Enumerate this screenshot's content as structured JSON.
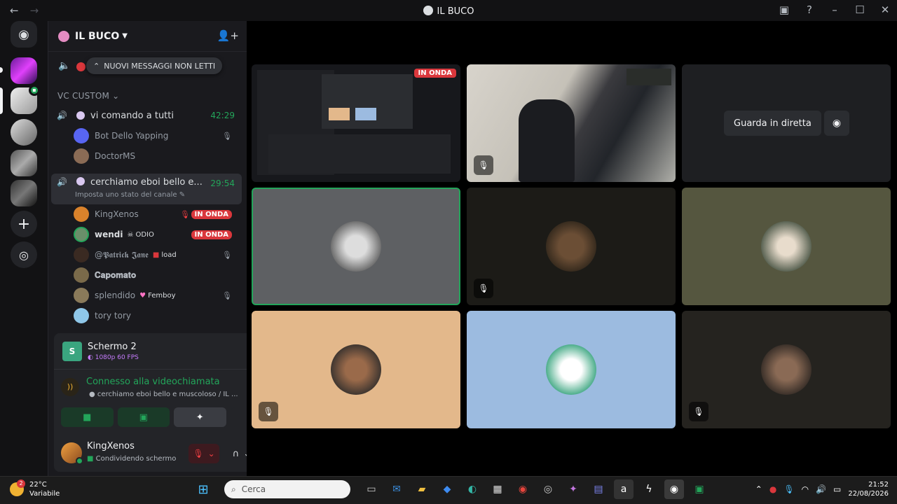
{
  "window": {
    "title": "IL BUCO"
  },
  "sidebar": {
    "server_name": "IL BUCO",
    "new_messages_pill": "NUOVI MESSAGGI NON LETTI",
    "category": "VC CUSTOM",
    "channel1": {
      "name": "vi comando a tutti",
      "timer": "42:29"
    },
    "channel1_users": [
      {
        "name": "Bot Dello Yapping"
      },
      {
        "name": "DoctorMS"
      }
    ],
    "channel2": {
      "name": "cerchiamo eboi bello e...",
      "timer": "29:54",
      "status_hint": "Imposta uno stato del canale"
    },
    "channel2_users": [
      {
        "name": "KingXenos",
        "live": "IN ONDA"
      },
      {
        "name": "wendi",
        "tag": "ODIO",
        "live": "IN ONDA"
      },
      {
        "name": "@𝕻𝖆𝖙𝖗𝖎𝖈𝖐 𝕵𝖆𝖓𝖊",
        "tag": "load"
      },
      {
        "name": "𝐂𝐚𝐩𝐨𝐦𝐚𝐭𝐨"
      },
      {
        "name": "splendido",
        "tag": "Femboy"
      },
      {
        "name": "tory tory"
      }
    ]
  },
  "voice": {
    "stream_title": "Schermo 2",
    "stream_quality": "1080p 60 FPS",
    "connected": "Connesso alla videochiamata",
    "channel_path": "cerchiamo eboi bello e muscoloso / IL ..."
  },
  "user": {
    "name": "KingXenos",
    "status": "Condividendo schermo"
  },
  "stage": {
    "live_tag": "IN ONDA",
    "watch_button": "Guarda in diretta"
  },
  "taskbar": {
    "temp": "22°C",
    "weather": "Variabile",
    "weather_badge": "2",
    "search_placeholder": "Cerca",
    "time": "21:52",
    "date": "22/08/2026"
  },
  "colors": {
    "accent_green": "#23a55a",
    "live_red": "#da373c"
  }
}
